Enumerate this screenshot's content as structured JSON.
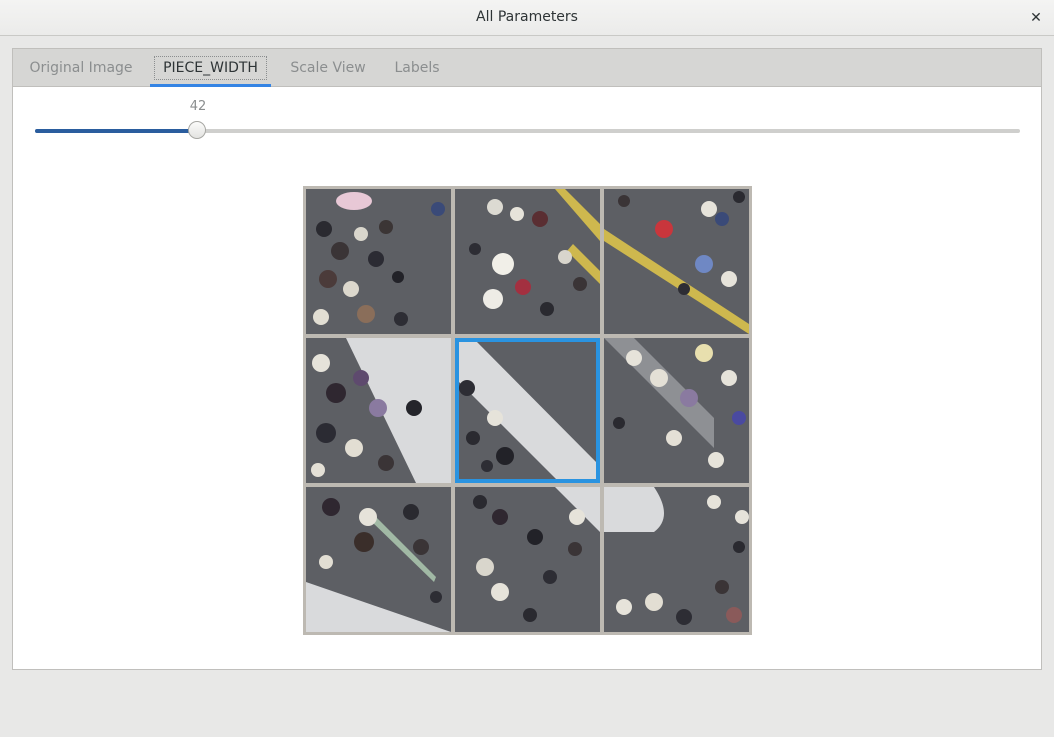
{
  "window": {
    "title": "All Parameters",
    "close_glyph": "✕"
  },
  "tabs": [
    {
      "label": "Original Image",
      "active": false
    },
    {
      "label": "PIECE_WIDTH",
      "active": true
    },
    {
      "label": "Scale View",
      "active": false
    },
    {
      "label": "Labels",
      "active": false
    }
  ],
  "slider": {
    "value": "42",
    "fraction": 0.164
  },
  "puzzle": {
    "grid": "3x3",
    "selected_tile": 4,
    "colors": {
      "selection": "#2a93e0",
      "grid_line": "#bdb9b2",
      "asphalt": "#5c5e63",
      "crosswalk": "#d9dadc",
      "road_line": "#e2c84a"
    }
  }
}
